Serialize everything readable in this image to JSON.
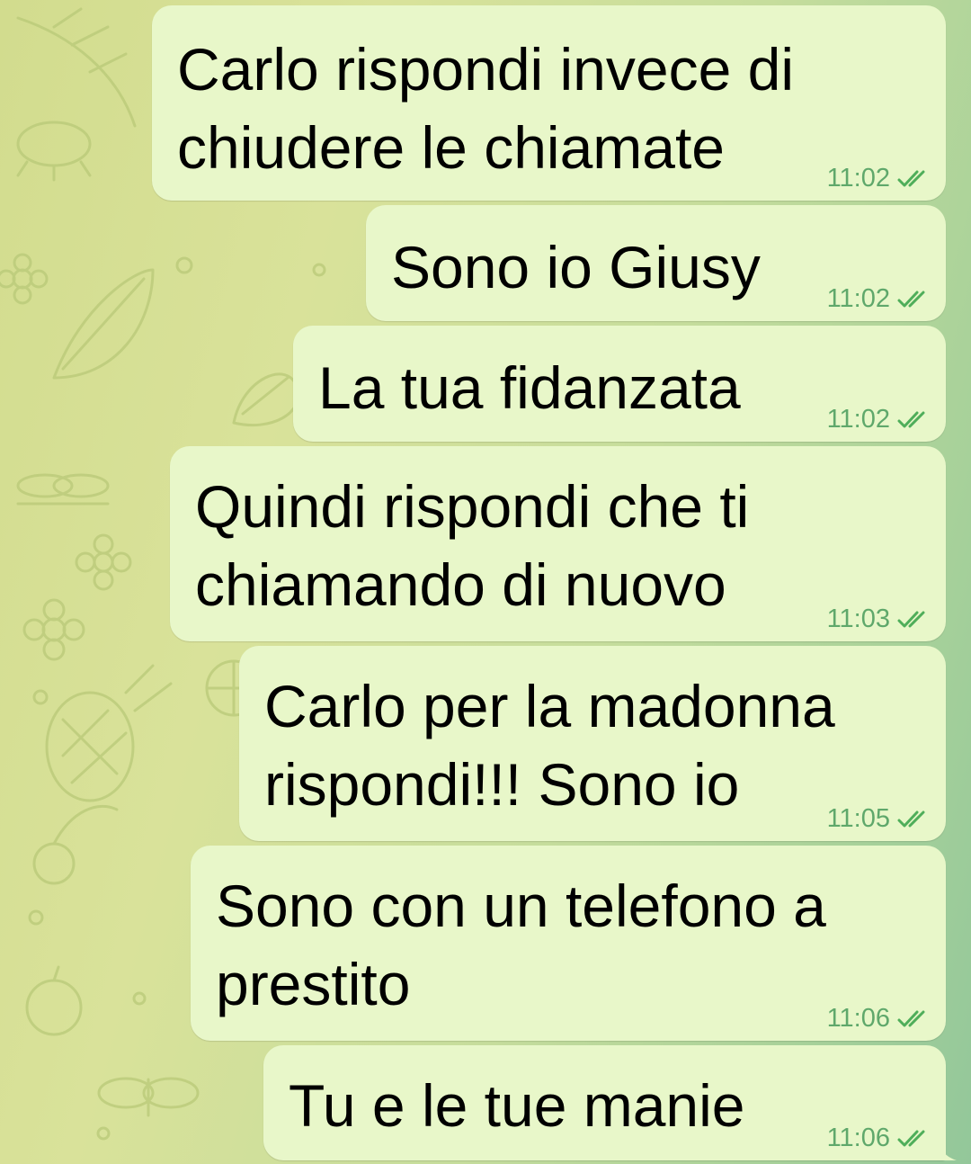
{
  "colors": {
    "bubble_bg": "#e8f7c9",
    "timestamp": "#5fa86b",
    "ticks": "#4fae5a",
    "wallpaper_doodle": "#b9c978"
  },
  "icons": {
    "read_receipt": "double-check-icon"
  },
  "messages": [
    {
      "text": "Carlo rispondi invece di\nchiudere le chiamate",
      "time": "11:02"
    },
    {
      "text": "Sono io Giusy",
      "time": "11:02"
    },
    {
      "text": "La tua fidanzata",
      "time": "11:02"
    },
    {
      "text": "Quindi rispondi che ti\nchiamando di nuovo",
      "time": "11:03"
    },
    {
      "text": "Carlo per la madonna\nrispondi!!! Sono io",
      "time": "11:05"
    },
    {
      "text": "Sono con un telefono a\nprestito",
      "time": "11:06"
    },
    {
      "text": "Tu e le tue manie",
      "time": "11:06"
    }
  ]
}
